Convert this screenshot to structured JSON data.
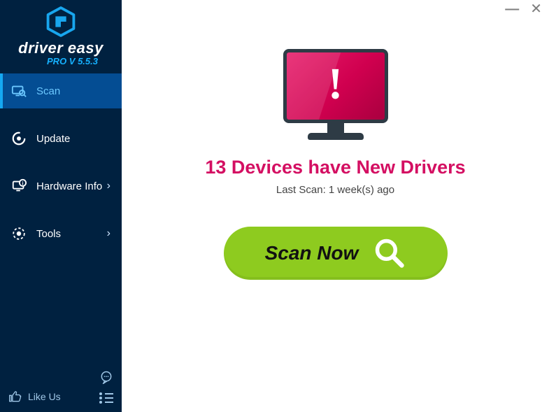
{
  "brand": {
    "name": "driver easy",
    "version_label": "PRO V 5.5.3"
  },
  "sidebar": {
    "items": [
      {
        "label": "Scan",
        "icon": "scan-icon",
        "active": true,
        "chevron": false
      },
      {
        "label": "Update",
        "icon": "update-icon",
        "active": false,
        "chevron": false
      },
      {
        "label": "Hardware Info",
        "icon": "hardware-icon",
        "active": false,
        "chevron": true
      },
      {
        "label": "Tools",
        "icon": "tools-icon",
        "active": false,
        "chevron": true
      }
    ],
    "like_label": "Like Us",
    "feedback_icon": "chat-icon",
    "menu_icon": "list-menu-icon"
  },
  "window": {
    "minimize": "—",
    "close": "✕"
  },
  "main": {
    "alert_symbol": "!",
    "headline": "13 Devices have New Drivers",
    "last_scan_label": "Last Scan: 1 week(s) ago",
    "scan_button_label": "Scan Now"
  },
  "colors": {
    "accent_red": "#d40f62",
    "action_green": "#8ecb1f",
    "sidebar_bg": "#002140",
    "sidebar_active": "#044d93",
    "brand_cyan": "#16b1ff"
  }
}
